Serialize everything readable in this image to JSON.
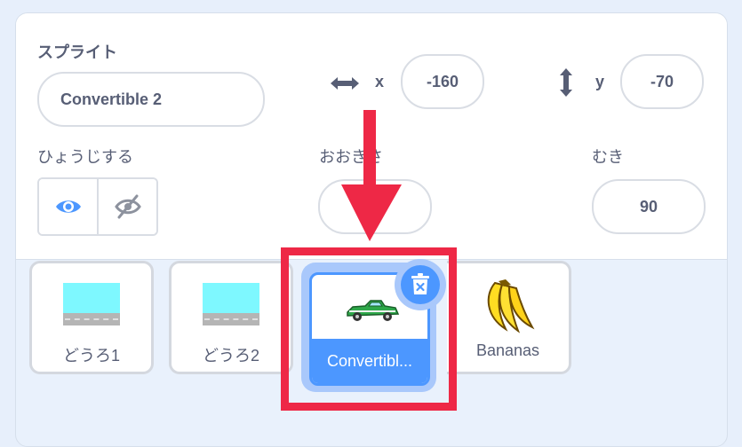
{
  "info": {
    "sprite_label": "スプライト",
    "sprite_name": "Convertible 2",
    "x_label": "x",
    "x_value": "-160",
    "y_label": "y",
    "y_value": "-70",
    "show_label": "ひょうじする",
    "size_label": "おおきさ",
    "size_value": "",
    "direction_label": "むき",
    "direction_value": "90"
  },
  "sprites": [
    {
      "name": "どうろ1",
      "thumb": "road"
    },
    {
      "name": "どうろ2",
      "thumb": "road"
    },
    {
      "name": "Convertibl...",
      "thumb": "green-car",
      "selected": true
    },
    {
      "name": "Bananas",
      "thumb": "bananas"
    }
  ],
  "colors": {
    "accent": "#4c97ff",
    "highlight_frame": "#ee2846",
    "text": "#575e75"
  },
  "icons": [
    "horizontal-arrows-icon",
    "vertical-arrows-icon",
    "eye-icon",
    "eye-slash-icon",
    "trash-icon",
    "annotation-arrow-icon"
  ]
}
